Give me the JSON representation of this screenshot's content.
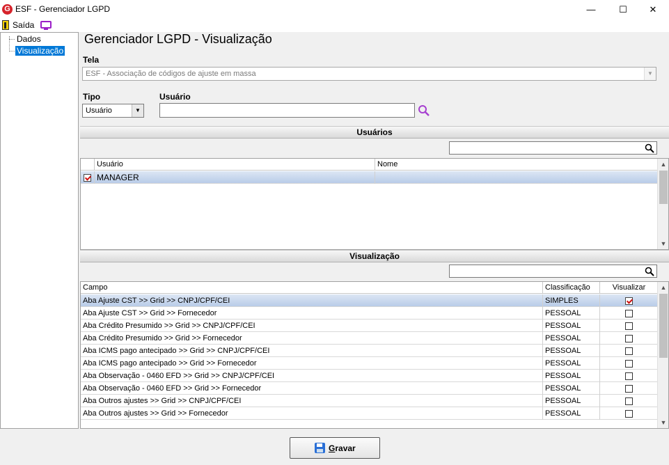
{
  "window": {
    "title": "ESF - Gerenciador LGPD",
    "app_icon_letter": "G",
    "minimize": "—",
    "maximize": "☐",
    "close": "✕"
  },
  "menu": {
    "exit_label": "Saída"
  },
  "tree": {
    "items": [
      {
        "label": "Dados",
        "selected": false
      },
      {
        "label": "Visualização",
        "selected": true
      }
    ]
  },
  "page": {
    "title": "Gerenciador LGPD - Visualização"
  },
  "form": {
    "tela_label": "Tela",
    "tela_value": "ESF - Associação de códigos de ajuste em massa",
    "tipo_label": "Tipo",
    "tipo_value": "Usuário",
    "usuario_label": "Usuário",
    "usuario_value": ""
  },
  "usuarios_section": {
    "header": "Usuários",
    "filter_value": "",
    "columns": [
      "Usuário",
      "Nome"
    ],
    "rows": [
      {
        "checked": true,
        "usuario": "MANAGER",
        "nome": ""
      }
    ]
  },
  "visualizacao_section": {
    "header": "Visualização",
    "filter_value": "",
    "columns": [
      "Campo",
      "Classificação",
      "Visualizar"
    ],
    "rows": [
      {
        "campo": "Aba Ajuste CST >> Grid >> CNPJ/CPF/CEI",
        "classificacao": "SIMPLES",
        "visualizar": true
      },
      {
        "campo": "Aba Ajuste CST >> Grid >> Fornecedor",
        "classificacao": "PESSOAL",
        "visualizar": false
      },
      {
        "campo": "Aba Crédito Presumido >> Grid >> CNPJ/CPF/CEI",
        "classificacao": "PESSOAL",
        "visualizar": false
      },
      {
        "campo": "Aba Crédito Presumido >> Grid >> Fornecedor",
        "classificacao": "PESSOAL",
        "visualizar": false
      },
      {
        "campo": "Aba ICMS pago antecipado >> Grid >> CNPJ/CPF/CEI",
        "classificacao": "PESSOAL",
        "visualizar": false
      },
      {
        "campo": "Aba ICMS pago antecipado >> Grid >> Fornecedor",
        "classificacao": "PESSOAL",
        "visualizar": false
      },
      {
        "campo": "Aba Observação - 0460 EFD >> Grid >> CNPJ/CPF/CEI",
        "classificacao": "PESSOAL",
        "visualizar": false
      },
      {
        "campo": "Aba Observação - 0460 EFD >> Grid >> Fornecedor",
        "classificacao": "PESSOAL",
        "visualizar": false
      },
      {
        "campo": "Aba Outros ajustes >> Grid >> CNPJ/CPF/CEI",
        "classificacao": "PESSOAL",
        "visualizar": false
      },
      {
        "campo": "Aba Outros ajustes >> Grid >> Fornecedor",
        "classificacao": "PESSOAL",
        "visualizar": false
      }
    ]
  },
  "footer": {
    "save_label_underlined": "G",
    "save_label_rest": "ravar"
  },
  "icons": {
    "exit": "exit-door-icon",
    "monitor": "monitor-icon",
    "search_purple": "search-icon",
    "filter_search": "search-icon",
    "save": "floppy-disk-icon"
  },
  "colors": {
    "selection": "#0078d7",
    "selected_row": "#c6d6ee",
    "brand": "#d6232b",
    "accent_purple": "#9b1fc8"
  }
}
